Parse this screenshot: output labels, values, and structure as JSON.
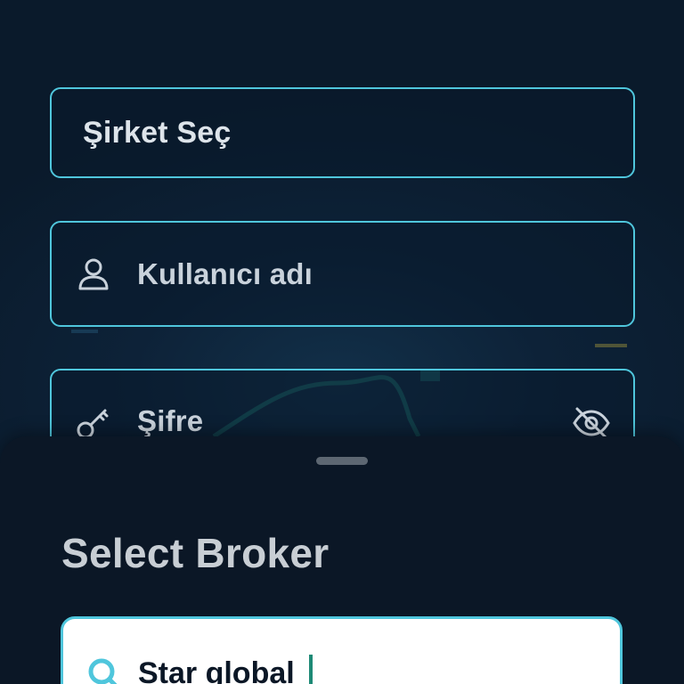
{
  "login": {
    "company_label": "Şirket Seç",
    "username_placeholder": "Kullanıcı adı",
    "password_placeholder": "Şifre"
  },
  "sheet": {
    "title": "Select Broker",
    "search_value": "Star global"
  },
  "icons": {
    "username": "user-icon",
    "password": "key-icon",
    "visibility": "eye-off-icon",
    "search": "search-icon"
  },
  "colors": {
    "accent": "#4fc6dc",
    "background": "#0a1a2b",
    "sheet": "#0b1726",
    "caret": "#1e8a76"
  }
}
